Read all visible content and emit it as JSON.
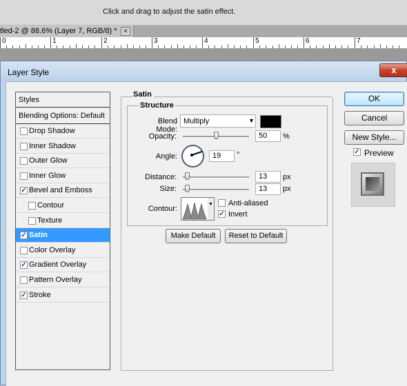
{
  "hint": {
    "text": "Click and drag to adjust the satin effect."
  },
  "document_tab": {
    "title": "tled-2 @ 88.6% (Layer 7, RGB/8) *",
    "close_glyph": "✕"
  },
  "ruler": {
    "numbers": [
      "0",
      "1",
      "2",
      "3",
      "4",
      "5",
      "6",
      "7"
    ]
  },
  "dialog": {
    "title": "Layer Style",
    "close_glyph": "x"
  },
  "styles_panel": {
    "header": "Styles",
    "blending_options": "Blending Options: Default",
    "items": [
      {
        "label": "Drop Shadow",
        "checked": false,
        "selected": false
      },
      {
        "label": "Inner Shadow",
        "checked": false,
        "selected": false
      },
      {
        "label": "Outer Glow",
        "checked": false,
        "selected": false
      },
      {
        "label": "Inner Glow",
        "checked": false,
        "selected": false
      },
      {
        "label": "Bevel and Emboss",
        "checked": true,
        "selected": false
      },
      {
        "label": "Contour",
        "checked": false,
        "selected": false
      },
      {
        "label": "Texture",
        "checked": false,
        "selected": false
      },
      {
        "label": "Satin",
        "checked": true,
        "selected": true
      },
      {
        "label": "Color Overlay",
        "checked": false,
        "selected": false
      },
      {
        "label": "Gradient Overlay",
        "checked": true,
        "selected": false
      },
      {
        "label": "Pattern Overlay",
        "checked": false,
        "selected": false
      },
      {
        "label": "Stroke",
        "checked": true,
        "selected": false
      }
    ]
  },
  "satin": {
    "group_title": "Satin",
    "structure_title": "Structure",
    "blend_mode": {
      "label": "Blend Mode:",
      "value": "Multiply",
      "color": "#000000"
    },
    "opacity": {
      "label": "Opacity:",
      "value": "50",
      "unit": "%",
      "level": 0.5
    },
    "angle": {
      "label": "Angle:",
      "value": "19",
      "unit": "°"
    },
    "distance": {
      "label": "Distance:",
      "value": "13",
      "unit": "px",
      "level": 0.06
    },
    "size": {
      "label": "Size:",
      "value": "13",
      "unit": "px",
      "level": 0.06
    },
    "contour": {
      "label": "Contour:",
      "anti_aliased_label": "Anti-aliased",
      "anti_aliased": false,
      "invert_label": "Invert",
      "invert": true
    },
    "make_default": "Make Default",
    "reset_to_default": "Reset to Default"
  },
  "actions": {
    "ok": "OK",
    "cancel": "Cancel",
    "new_style": "New Style...",
    "preview_label": "Preview",
    "preview_checked": true
  }
}
